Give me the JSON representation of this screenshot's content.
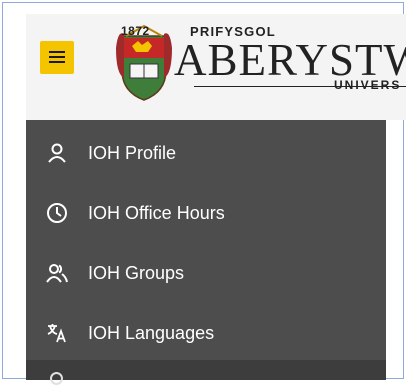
{
  "header": {
    "menu_icon": "hamburger-icon",
    "logo": {
      "year": "1872",
      "prifysgol": "PRIFYSGOL",
      "wordmark": "ABERYSTWYT",
      "university": "UNIVERS"
    }
  },
  "sidebar": {
    "items": [
      {
        "label": "IOH Profile",
        "icon": "person-icon"
      },
      {
        "label": "IOH Office Hours",
        "icon": "clock-icon"
      },
      {
        "label": "IOH Groups",
        "icon": "people-icon"
      },
      {
        "label": "IOH Languages",
        "icon": "translate-icon"
      }
    ]
  },
  "colors": {
    "menu_button": "#f5c400",
    "sidebar_bg": "#4d4d4d",
    "header_bg": "#f4f4f4",
    "frame_border": "#8ea9db"
  }
}
